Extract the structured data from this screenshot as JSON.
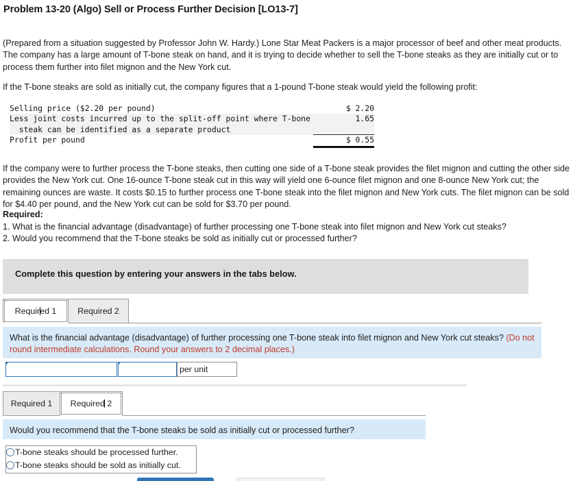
{
  "title": "Problem 13-20 (Algo) Sell or Process Further Decision [LO13-7]",
  "paragraphs": {
    "intro": "(Prepared from a situation suggested by Professor John W. Hardy.) Lone Star Meat Packers is a major processor of beef and other meat products. The company has a large amount of T-bone steak on hand, and it is trying to decide whether to sell the T-bone steaks as they are initially cut or to process them further into filet mignon and the New York cut.",
    "lead_in": "If the T-bone steaks are sold as initially cut, the company figures that a 1-pound T-bone steak would yield the following profit:",
    "processing": "If the company were to further process the T-bone steaks, then cutting one side of a T-bone steak provides the filet mignon and cutting the other side provides the New York cut. One 16-ounce T-bone steak cut in this way will yield one 6-ounce filet mignon and one 8-ounce New York cut; the remaining ounces are waste. It costs $0.15 to further process one T-bone steak into the filet mignon and New York cuts. The filet mignon can be sold for $4.40 per pound, and the New York cut can be sold for $3.70 per pound."
  },
  "financial_table": {
    "rows": [
      {
        "label": "Selling price ($2.20 per pound)",
        "amount": "$ 2.20",
        "shaded": false,
        "rule": "none"
      },
      {
        "label": "Less joint costs incurred up to the split-off point where T-bone\n  steak can be identified as a separate product",
        "amount": "1.65",
        "shaded": true,
        "rule": "thin"
      },
      {
        "label": "Profit per pound",
        "amount": "$ 0.55",
        "shaded": false,
        "rule": "thick"
      }
    ]
  },
  "required": {
    "heading": "Required:",
    "item_1": "1. What is the financial advantage (disadvantage) of further processing one T-bone steak into filet mignon and New York cut steaks?",
    "item_2": "2. Would you recommend that the T-bone steaks be sold as initially cut or processed further?"
  },
  "instruction_banner": "Complete this question by entering your answers in the tabs below.",
  "widget_1": {
    "tabs": [
      {
        "label": "Required 1",
        "active": true
      },
      {
        "label": "Required 2",
        "active": false
      }
    ],
    "question_main": "What is the financial advantage (disadvantage) of further processing one T-bone steak into filet mignon and New York cut steaks?",
    "question_note": "(Do not round intermediate calculations. Round your answers to 2 decimal places.)",
    "note_color": "#c0392b",
    "answer_row": {
      "field_label": "",
      "field_label_value": "",
      "field_amount_value": "",
      "unit_label": "per unit"
    }
  },
  "widget_2": {
    "tabs": [
      {
        "label": "Required 1",
        "active": false
      },
      {
        "label": "Required 2",
        "active": true
      }
    ],
    "question": "Would you recommend that the T-bone steaks be sold as initially cut or processed further?",
    "options": [
      {
        "label": "T-bone steaks should be processed further.",
        "selected": false
      },
      {
        "label": "T-bone steaks should be sold as initially cut.",
        "selected": false
      }
    ]
  },
  "footer_buttons": {
    "primary_color": "#2e74b5",
    "secondary_color": "#eef2f6"
  }
}
